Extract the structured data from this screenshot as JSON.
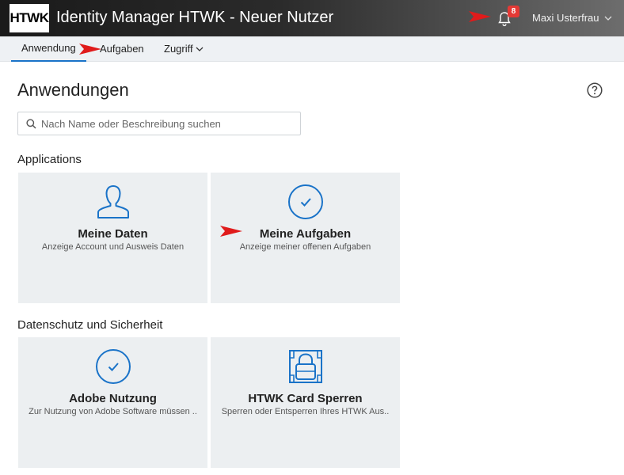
{
  "header": {
    "logo_text": "HTWK",
    "title": "Identity Manager HTWK - Neuer Nutzer",
    "notifications_count": "8",
    "user_name": "Maxi Usterfrau",
    "icons": {
      "bell": "bell-icon",
      "user_menu": "chevron-down-icon"
    }
  },
  "nav": {
    "tabs": [
      {
        "label": "Anwendung",
        "active": true
      },
      {
        "label": "Aufgaben",
        "active": false
      },
      {
        "label": "Zugriff",
        "active": false
      }
    ]
  },
  "main": {
    "title": "Anwendungen",
    "search_placeholder": "Nach Name oder Beschreibung suchen",
    "sections": [
      {
        "title": "Applications",
        "tiles": [
          {
            "title": "Meine Daten",
            "desc": "Anzeige Account und Ausweis Daten",
            "icon": "user-icon"
          },
          {
            "title": "Meine Aufgaben",
            "desc": "Anzeige meiner offenen Aufgaben",
            "icon": "check-circle-icon"
          }
        ]
      },
      {
        "title": "Datenschutz und Sicherheit",
        "tiles": [
          {
            "title": "Adobe Nutzung",
            "desc": "Zur Nutzung von Adobe Software müssen ..",
            "icon": "check-circle-icon"
          },
          {
            "title": "HTWK Card Sperren",
            "desc": "Sperren oder Entsperren Ihres HTWK Aus..",
            "icon": "card-lock-icon"
          }
        ]
      }
    ]
  },
  "colors": {
    "accent": "#1a73c8",
    "badge": "#e53935",
    "tile_bg": "#eceff1",
    "annotation_arrow": "#e01b1b"
  }
}
